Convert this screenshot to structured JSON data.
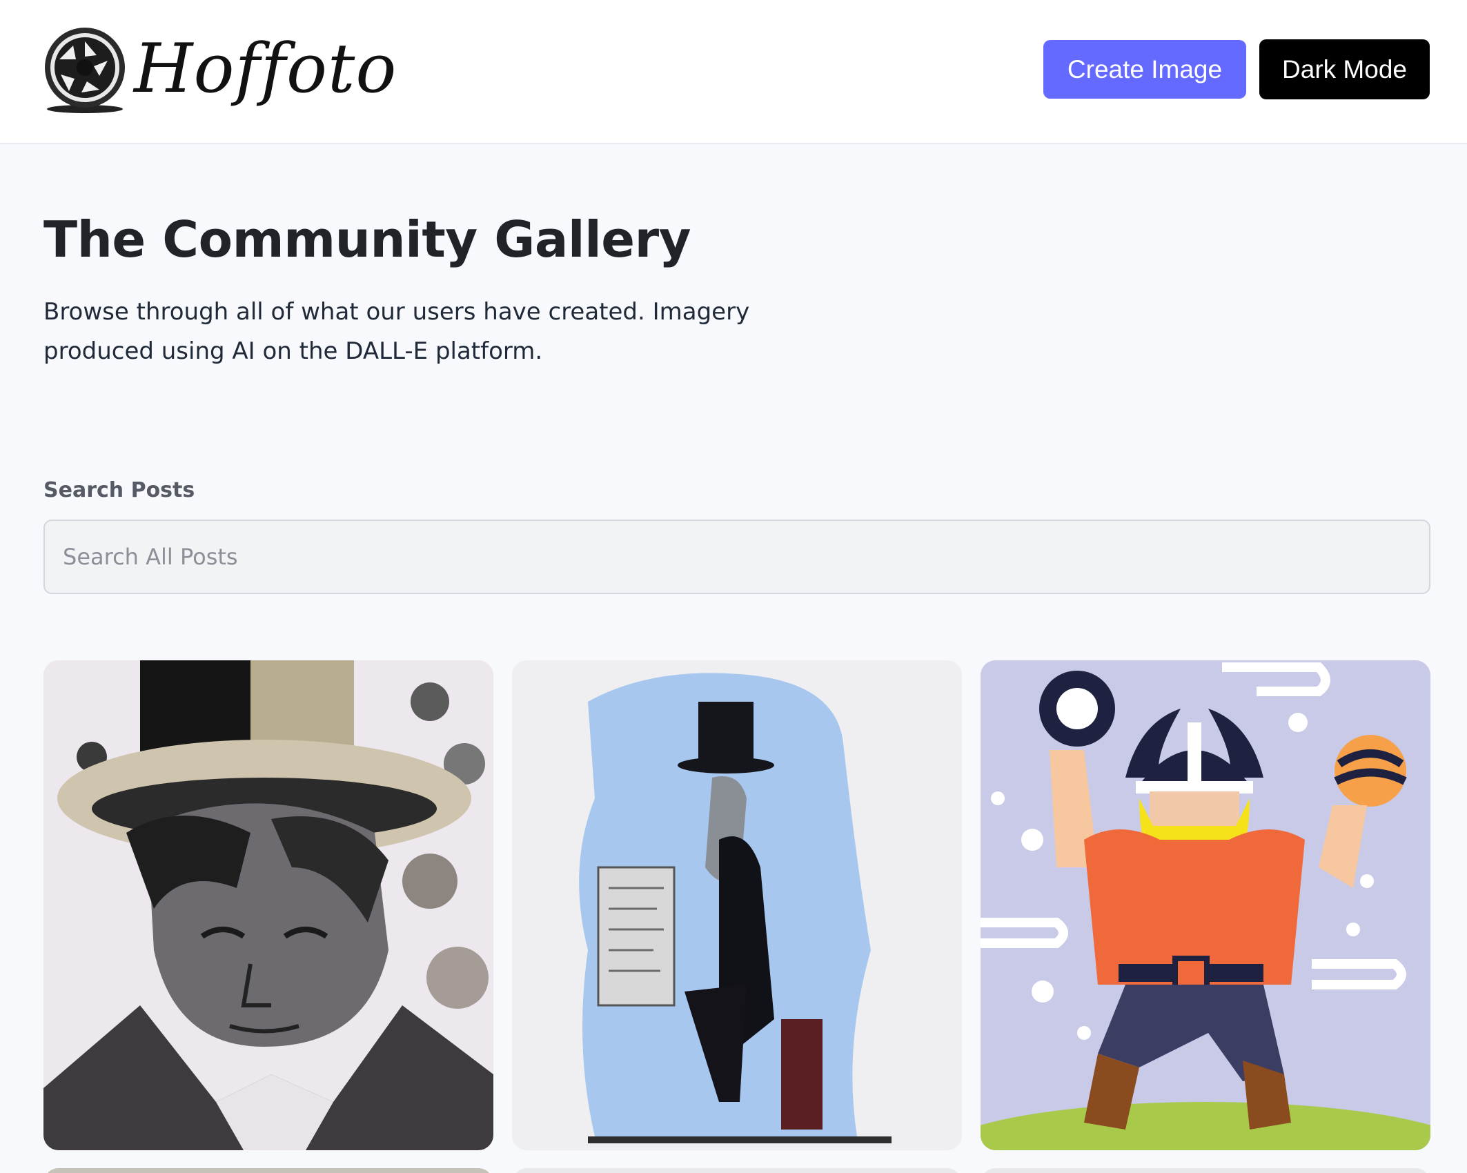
{
  "header": {
    "brand_name": "Hoffoto",
    "create_button_label": "Create Image",
    "dark_mode_button_label": "Dark Mode"
  },
  "intro": {
    "title": "The Community Gallery",
    "subtitle": "Browse through all of what our users have created. Imagery produced using AI on the DALL-E platform."
  },
  "search": {
    "label": "Search Posts",
    "placeholder": "Search All Posts",
    "value": ""
  },
  "colors": {
    "accent": "#6469ff",
    "dark_button": "#000000",
    "page_background": "#f8f9fc"
  },
  "gallery": {
    "cards": [
      {
        "image": "watercolor portrait of a man in a wide-brimmed hat"
      },
      {
        "image": "watercolor of a bearded man in a top hat reading a scroll"
      },
      {
        "image": "flat illustration of a viking with horned helmet juggling balls"
      }
    ]
  }
}
